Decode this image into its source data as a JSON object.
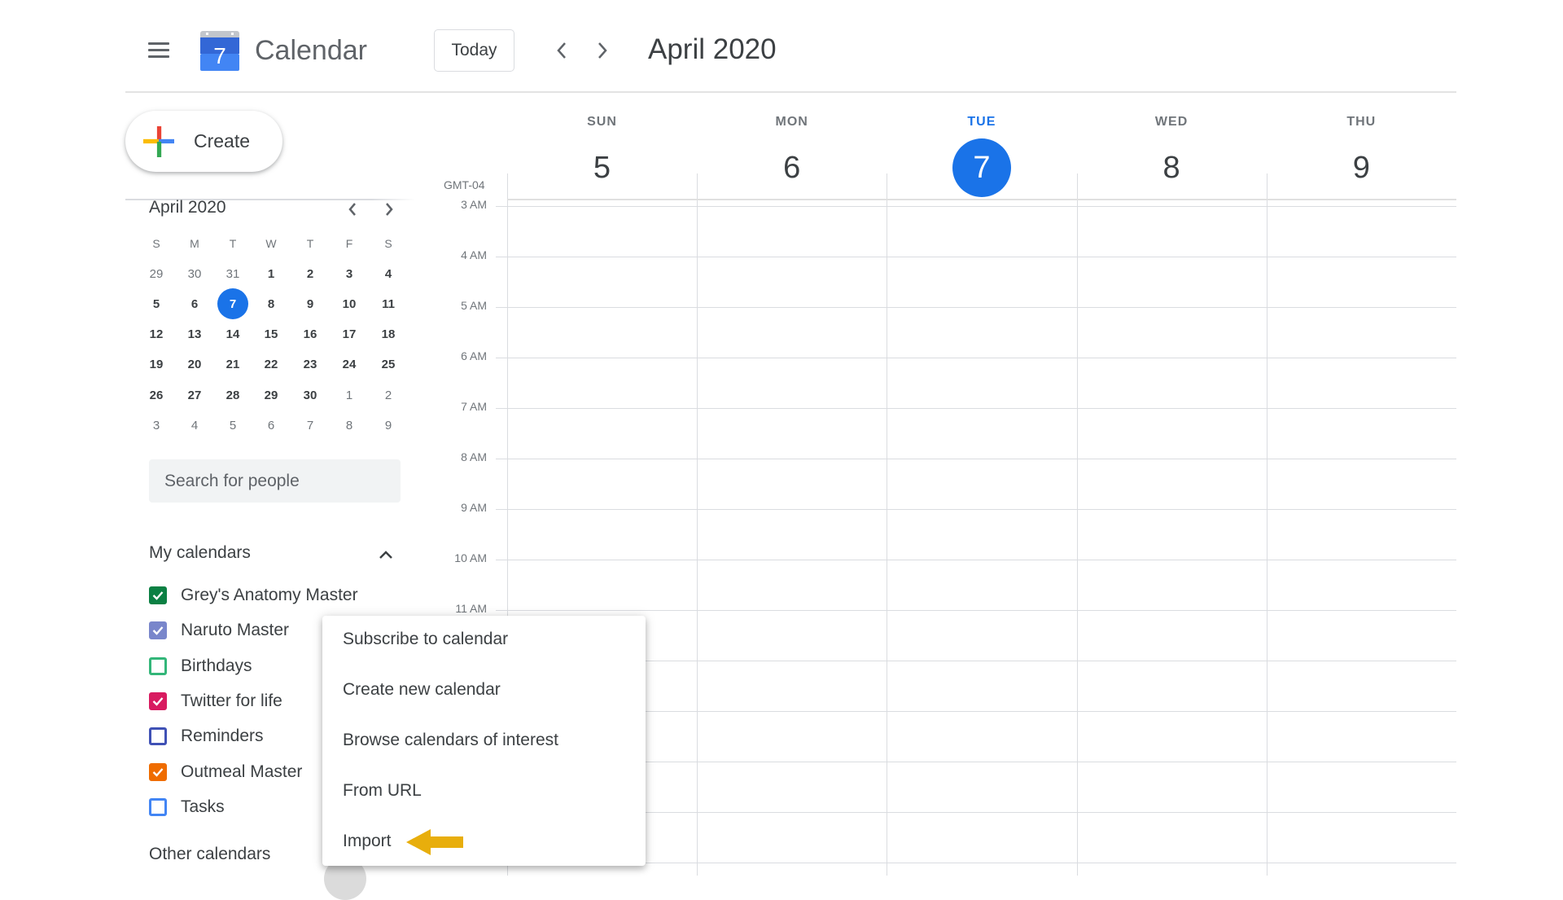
{
  "header": {
    "menu_icon": "hamburger-menu-icon",
    "logo_day": "7",
    "app_title": "Calendar",
    "today_label": "Today",
    "prev_icon": "chevron-left-icon",
    "next_icon": "chevron-right-icon",
    "period_title": "April 2020"
  },
  "sidebar": {
    "create_label": "Create",
    "mini_calendar": {
      "title": "April 2020",
      "weekday_headers": [
        "S",
        "M",
        "T",
        "W",
        "T",
        "F",
        "S"
      ],
      "weeks": [
        [
          {
            "d": "29",
            "dim": true
          },
          {
            "d": "30",
            "dim": true
          },
          {
            "d": "31",
            "dim": true
          },
          {
            "d": "1"
          },
          {
            "d": "2"
          },
          {
            "d": "3"
          },
          {
            "d": "4"
          }
        ],
        [
          {
            "d": "5"
          },
          {
            "d": "6"
          },
          {
            "d": "7",
            "today": true
          },
          {
            "d": "8"
          },
          {
            "d": "9"
          },
          {
            "d": "10"
          },
          {
            "d": "11"
          }
        ],
        [
          {
            "d": "12"
          },
          {
            "d": "13"
          },
          {
            "d": "14"
          },
          {
            "d": "15"
          },
          {
            "d": "16"
          },
          {
            "d": "17"
          },
          {
            "d": "18"
          }
        ],
        [
          {
            "d": "19"
          },
          {
            "d": "20"
          },
          {
            "d": "21"
          },
          {
            "d": "22"
          },
          {
            "d": "23"
          },
          {
            "d": "24"
          },
          {
            "d": "25"
          }
        ],
        [
          {
            "d": "26"
          },
          {
            "d": "27"
          },
          {
            "d": "28"
          },
          {
            "d": "29"
          },
          {
            "d": "30"
          },
          {
            "d": "1",
            "dim": true
          },
          {
            "d": "2",
            "dim": true
          }
        ],
        [
          {
            "d": "3",
            "dim": true
          },
          {
            "d": "4",
            "dim": true
          },
          {
            "d": "5",
            "dim": true
          },
          {
            "d": "6",
            "dim": true
          },
          {
            "d": "7",
            "dim": true
          },
          {
            "d": "8",
            "dim": true
          },
          {
            "d": "9",
            "dim": true
          }
        ]
      ]
    },
    "search_placeholder": "Search for people",
    "my_calendars_title": "My calendars",
    "my_calendars": [
      {
        "label": "Grey's Anatomy Master",
        "checked": true,
        "color": "#0b8043"
      },
      {
        "label": "Naruto Master",
        "checked": true,
        "color": "#7986cb"
      },
      {
        "label": "Birthdays",
        "checked": false,
        "color": "#33b679"
      },
      {
        "label": "Twitter for life",
        "checked": true,
        "color": "#d81b60"
      },
      {
        "label": "Reminders",
        "checked": false,
        "color": "#3f51b5"
      },
      {
        "label": "Outmeal Master",
        "checked": true,
        "color": "#ef6c00"
      },
      {
        "label": "Tasks",
        "checked": false,
        "color": "#4285f4"
      }
    ],
    "other_calendars_title": "Other calendars"
  },
  "week": {
    "timezone": "GMT-04",
    "days": [
      {
        "name": "SUN",
        "num": "5",
        "today": false
      },
      {
        "name": "MON",
        "num": "6",
        "today": false
      },
      {
        "name": "TUE",
        "num": "7",
        "today": true
      },
      {
        "name": "WED",
        "num": "8",
        "today": false
      },
      {
        "name": "THU",
        "num": "9",
        "today": false
      }
    ],
    "hours": [
      "3 AM",
      "4 AM",
      "5 AM",
      "6 AM",
      "7 AM",
      "8 AM",
      "9 AM",
      "10 AM",
      "11 AM"
    ],
    "extra_hour_rows": 5
  },
  "add_calendar_menu": {
    "items": [
      "Subscribe to calendar",
      "Create new calendar",
      "Browse calendars of interest",
      "From URL",
      "Import"
    ],
    "highlight_arrow_color": "#e8ae0c",
    "highlighted_item": "Import"
  },
  "colors": {
    "accent": "#1a73e8"
  }
}
